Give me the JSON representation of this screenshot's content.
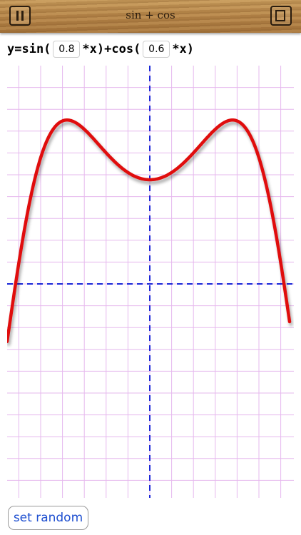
{
  "header": {
    "title": "sin + cos",
    "left_icon": "pause-icon",
    "right_icon": "square-icon"
  },
  "formula": {
    "prefix": "y=sin(",
    "a": "0.8",
    "mid": "*x)+cos(",
    "b": "0.6",
    "suffix": "*x)"
  },
  "actions": {
    "random_label": "set random"
  },
  "colors": {
    "curve": "#e01010",
    "axes": "#1a28d8",
    "grid": "#e6b8ee",
    "wood": "#b8874a"
  }
}
